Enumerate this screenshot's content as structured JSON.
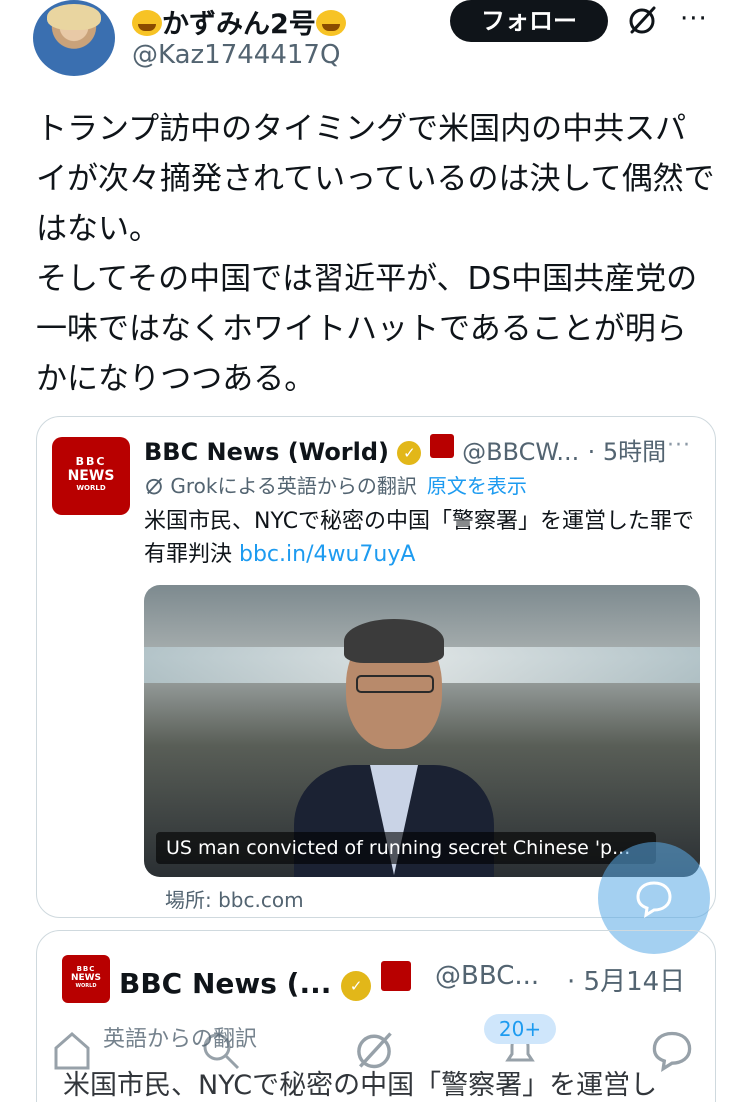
{
  "header": {
    "display_name": "かずみん2号",
    "handle": "@Kaz1744417Q",
    "follow_label": "フォロー",
    "more_label": "···"
  },
  "tweet": {
    "paragraphs": [
      "トランプ訪中のタイミングで米国内の中共スパイが次々摘発されていっているのは決して偶然ではない。",
      "そしてその中国では習近平が、DS中国共産党の一味ではなくホワイトハットであることが明らかになりつつある。"
    ]
  },
  "quote": {
    "logo": {
      "line1": "BBC",
      "line2": "NEWS",
      "line3": "WORLD"
    },
    "name": "BBC News (World)",
    "handle": "@BBCW...",
    "time": "· 5時間",
    "more_label": "···",
    "translate_label": "Grokによる英語からの翻訳",
    "show_original_label": "原文を表示",
    "text": "米国市民、NYCで秘密の中国「警察署」を運営した罪で有罪判決 ",
    "link": "bbc.in/4wu7uyA",
    "media_caption": "US man convicted of running secret Chinese 'p...",
    "source_label": "場所: bbc.com"
  },
  "quote2": {
    "logo": {
      "line1": "BBC",
      "line2": "NEWS",
      "line3": "WORLD"
    },
    "name": "BBC News (...",
    "handle": "@BBC...",
    "date": "· 5月14日",
    "translate_label": "英語からの翻訳",
    "text": "米国市民、NYCで秘密の中国「警察署」を運営し"
  },
  "tabbar": {
    "badge": "20+",
    "icons": [
      "home-icon",
      "search-icon",
      "grok-icon",
      "notifications-icon",
      "messages-icon"
    ]
  },
  "colors": {
    "accent": "#1d9bf0",
    "bbc_red": "#b80000",
    "text": "#0f1419",
    "secondary_text": "#536471"
  }
}
